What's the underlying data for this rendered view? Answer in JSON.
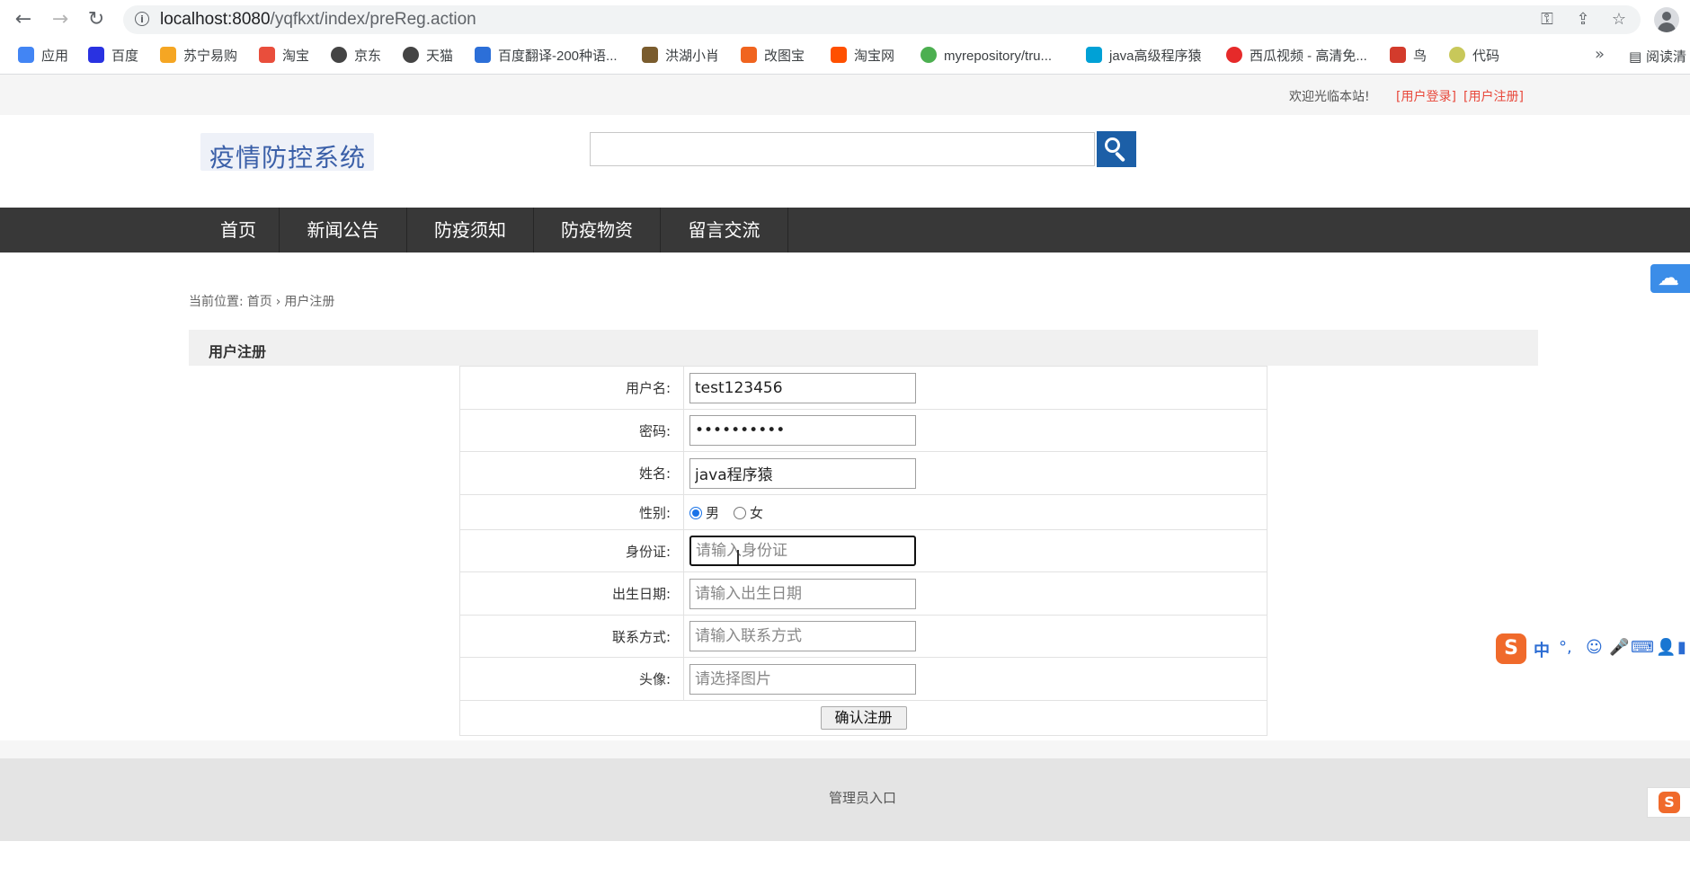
{
  "browser": {
    "url_host": "localhost:8080",
    "url_path": "/yqfkxt/index/preReg.action",
    "bookmarks": [
      "应用",
      "百度",
      "苏宁易购",
      "淘宝",
      "京东",
      "天猫",
      "百度翻译-200种语...",
      "洪湖小肖",
      "改图宝",
      "淘宝网",
      "myrepository/tru...",
      "java高级程序猿",
      "西瓜视频 - 高清免...",
      "鸟",
      "代码"
    ],
    "bookmark_icon_colors": [
      "#4285f4",
      "#2932e1",
      "#f5a623",
      "#e94e3c",
      "#444444",
      "#444444",
      "#2c6fd8",
      "#7a5c2e",
      "#f0641f",
      "#ff5000",
      "#4caf50",
      "#00a1d6",
      "#e62a2a",
      "#d33b2c",
      "#c8c85a"
    ],
    "more_label": "»",
    "reading_list": "阅读清"
  },
  "topbar": {
    "welcome": "欢迎光临本站!",
    "login": "[用户登录]",
    "register": "[用户注册]"
  },
  "header": {
    "logo_text": "疫情防控系统",
    "search_placeholder": ""
  },
  "nav": {
    "items": [
      "首页",
      "新闻公告",
      "防疫须知",
      "防疫物资",
      "留言交流"
    ]
  },
  "breadcrumb": {
    "prefix": "当前位置:",
    "home": "首页",
    "separator": "›",
    "current": "用户注册"
  },
  "form": {
    "title": "用户注册",
    "username_label": "用户名:",
    "username_value": "test123456",
    "password_label": "密码:",
    "password_value": "1234567890",
    "name_label": "姓名:",
    "name_value": "java程序猿",
    "gender_label": "性别:",
    "gender_male": "男",
    "gender_female": "女",
    "gender_selected": "男",
    "idcard_label": "身份证:",
    "idcard_placeholder": "请输入身份证",
    "birth_label": "出生日期:",
    "birth_placeholder": "请输入出生日期",
    "contact_label": "联系方式:",
    "contact_placeholder": "请输入联系方式",
    "avatar_label": "头像:",
    "avatar_placeholder": "请选择图片",
    "submit_label": "确认注册"
  },
  "footer": {
    "admin_link": "管理员入口"
  },
  "ime": {
    "logo": "S",
    "mode": "中",
    "punct": "°,"
  }
}
